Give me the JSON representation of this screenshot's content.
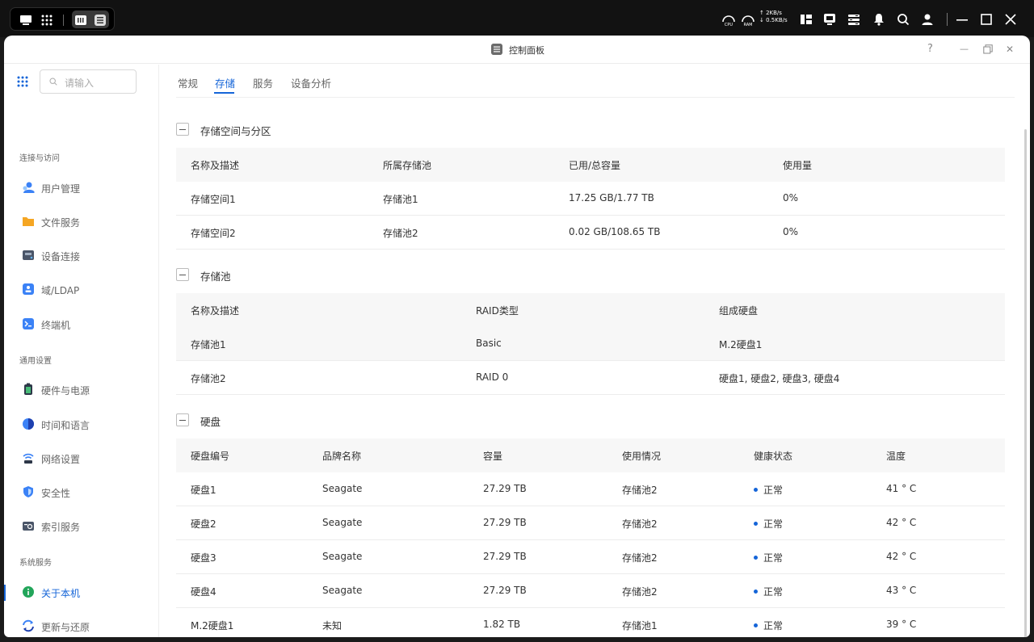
{
  "topbar": {
    "net_up": "↑ 2KB/s",
    "net_down": "↓ 0.5KB/s"
  },
  "window": {
    "title": "控制面板",
    "help": "?",
    "minimize": "—",
    "close": "✕"
  },
  "sidebar": {
    "search_placeholder": "请输入",
    "groups": [
      "连接与访问",
      "通用设置",
      "系统服务"
    ],
    "items": [
      {
        "label": "用户管理",
        "color": "#3b82f6"
      },
      {
        "label": "文件服务",
        "color": "#f5a623"
      },
      {
        "label": "设备连接",
        "color": "#4a5568"
      },
      {
        "label": "域/LDAP",
        "color": "#3b82f6"
      },
      {
        "label": "终端机",
        "color": "#3b82f6"
      },
      {
        "label": "硬件与电源",
        "color": "#22a55a"
      },
      {
        "label": "时间和语言",
        "color": "#3b82f6"
      },
      {
        "label": "网络设置",
        "color": "#3b82f6"
      },
      {
        "label": "安全性",
        "color": "#3b82f6"
      },
      {
        "label": "索引服务",
        "color": "#4a5568"
      },
      {
        "label": "关于本机",
        "color": "#22a55a"
      },
      {
        "label": "更新与还原",
        "color": "#3b82f6"
      }
    ],
    "active_index": 10
  },
  "tabs": [
    "常规",
    "存储",
    "服务",
    "设备分析"
  ],
  "active_tab": 1,
  "sections": {
    "space": {
      "title": "存储空间与分区",
      "headers": [
        "名称及描述",
        "所属存储池",
        "已用/总容量",
        "使用量"
      ],
      "rows": [
        [
          "存储空间1",
          "存储池1",
          "17.25 GB/1.77 TB",
          "0%"
        ],
        [
          "存储空间2",
          "存储池2",
          "0.02 GB/108.65 TB",
          "0%"
        ]
      ]
    },
    "pool": {
      "title": "存储池",
      "headers": [
        "名称及描述",
        "RAID类型",
        "组成硬盘"
      ],
      "rows": [
        [
          "存储池1",
          "Basic",
          "M.2硬盘1"
        ],
        [
          "存储池2",
          "RAID 0",
          "硬盘1, 硬盘2, 硬盘3, 硬盘4"
        ]
      ]
    },
    "disk": {
      "title": "硬盘",
      "headers": [
        "硬盘编号",
        "品牌名称",
        "容量",
        "使用情况",
        "健康状态",
        "温度"
      ],
      "rows": [
        [
          "硬盘1",
          "Seagate",
          "27.29 TB",
          "存储池2",
          "正常",
          "41 ° C"
        ],
        [
          "硬盘2",
          "Seagate",
          "27.29 TB",
          "存储池2",
          "正常",
          "42 ° C"
        ],
        [
          "硬盘3",
          "Seagate",
          "27.29 TB",
          "存储池2",
          "正常",
          "42 ° C"
        ],
        [
          "硬盘4",
          "Seagate",
          "27.29 TB",
          "存储池2",
          "正常",
          "43 ° C"
        ],
        [
          "M.2硬盘1",
          "未知",
          "1.82 TB",
          "存储池1",
          "正常",
          "39 ° C"
        ]
      ]
    }
  },
  "colors": {
    "accent": "#1565d8",
    "status_ok": "#1565d8"
  }
}
